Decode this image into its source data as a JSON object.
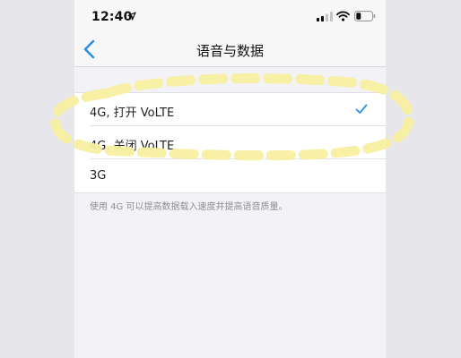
{
  "status_bar": {
    "time": "12:40",
    "location_icon": "location-arrow-icon",
    "signal_icon": "cellular-signal-icon",
    "wifi_icon": "wifi-icon",
    "battery_icon": "battery-icon"
  },
  "nav": {
    "back_icon": "chevron-left-icon",
    "title": "语音与数据"
  },
  "options": [
    {
      "label": "4G, 打开 VoLTE",
      "selected": true
    },
    {
      "label": "4G, 关闭 VoLTE",
      "selected": false
    },
    {
      "label": "3G",
      "selected": false
    }
  ],
  "footnote": "使用 4G 可以提高数据载入速度并提高语音质量。",
  "colors": {
    "accent": "#2f8fe0",
    "annotation": "#f7efa0"
  }
}
